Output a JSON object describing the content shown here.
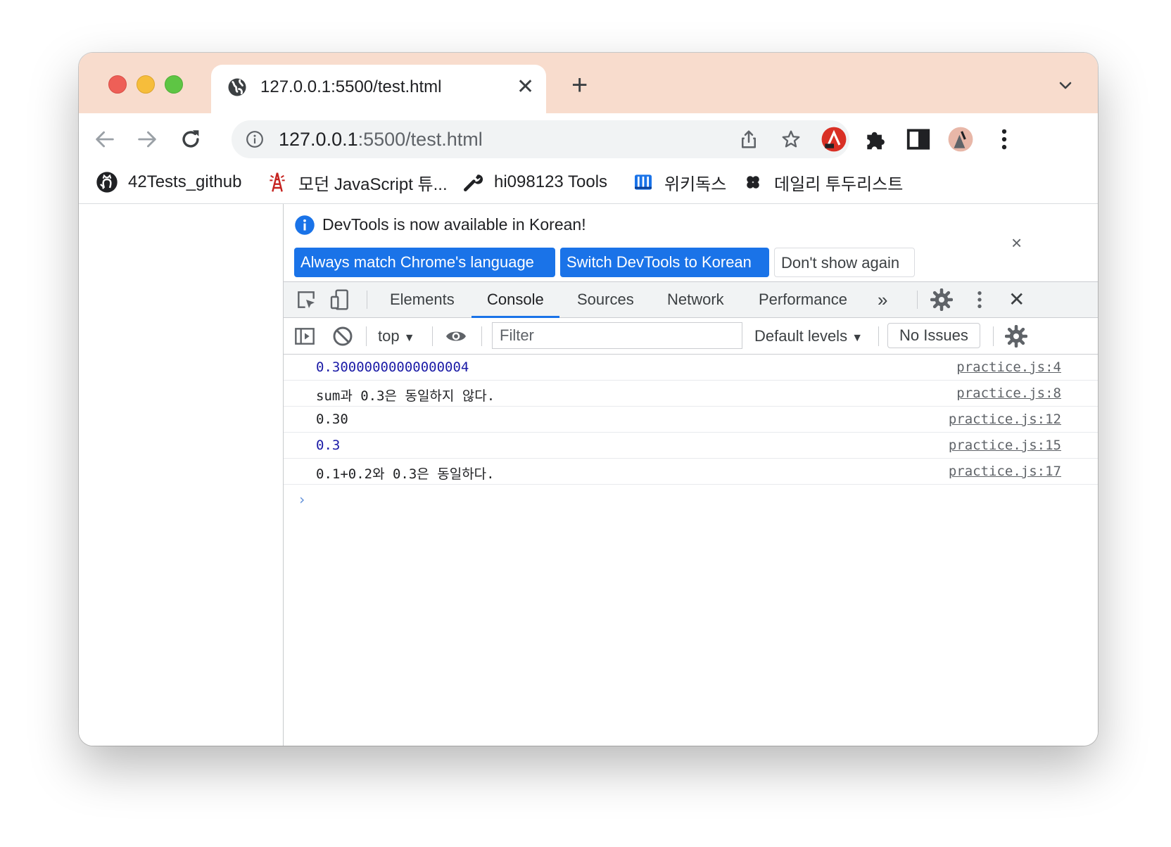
{
  "browser": {
    "tab": {
      "title": "127.0.0.1:5500/test.html",
      "close_glyph": "✕"
    },
    "new_tab_glyph": "+",
    "url_host": "127.0.0.1",
    "url_rest": ":5500/test.html"
  },
  "bookmarks": [
    {
      "label": "42Tests_github",
      "icon": "github-icon"
    },
    {
      "label": "모던 JavaScript 튜...",
      "icon": "tower-icon"
    },
    {
      "label": "hi098123 Tools",
      "icon": "wrench-icon"
    },
    {
      "label": "위키독스",
      "icon": "wikidocs-icon"
    },
    {
      "label": "데일리 투두리스트",
      "icon": "clover-icon"
    }
  ],
  "infobar": {
    "message": "DevTools is now available in Korean!",
    "btn_match": "Always match Chrome's language",
    "btn_switch": "Switch DevTools to Korean",
    "btn_dont_show": "Don't show again",
    "close_glyph": "×"
  },
  "devtools": {
    "tabs": [
      "Elements",
      "Console",
      "Sources",
      "Network",
      "Performance"
    ],
    "active_tab": "Console",
    "more_glyph": "»",
    "close_glyph": "✕"
  },
  "console": {
    "context": "top",
    "context_arrow": "▼",
    "filter_placeholder": "Filter",
    "levels": "Default levels",
    "levels_arrow": "▼",
    "issues": "No Issues",
    "prompt": "›",
    "logs": [
      {
        "text": "0.30000000000000004",
        "source": "practice.js:4"
      },
      {
        "text": "sum과 0.3은 동일하지 않다.",
        "source": "practice.js:8"
      },
      {
        "text": "0.30",
        "source": "practice.js:12"
      },
      {
        "text": "0.3",
        "source": "practice.js:15"
      },
      {
        "text": "0.1+0.2와 0.3은 동일하다.",
        "source": "practice.js:17"
      }
    ]
  },
  "colors": {
    "tabstrip": "#f8dccd",
    "accent": "#1a73e8",
    "number": "#1a1aa6"
  }
}
